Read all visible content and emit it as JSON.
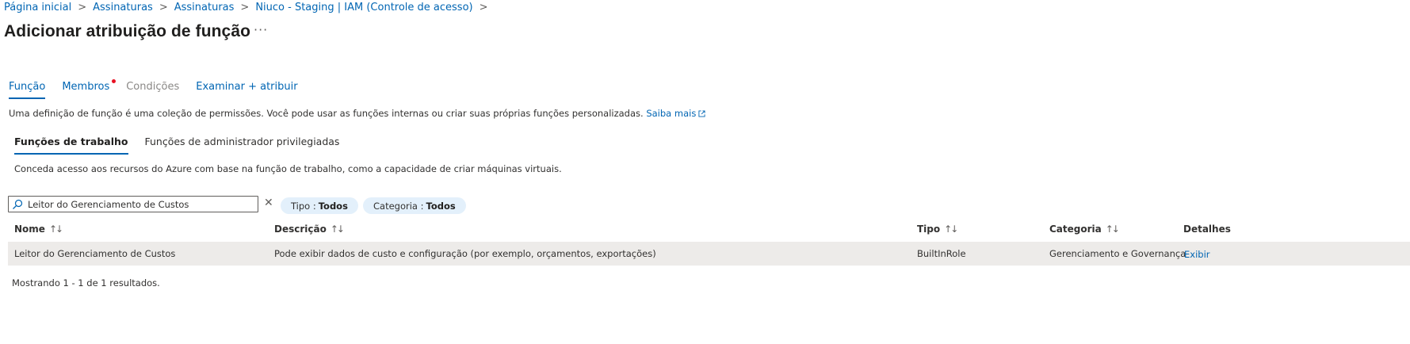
{
  "breadcrumb": {
    "items": [
      "Página inicial",
      "Assinaturas",
      "Assinaturas",
      "Niuco - Staging | IAM (Controle de acesso)"
    ],
    "separator": ">"
  },
  "page": {
    "title": "Adicionar atribuição de função",
    "more": "···"
  },
  "tabs": {
    "items": [
      "Função",
      "Membros",
      "Condições",
      "Examinar + atribuir"
    ]
  },
  "description": {
    "text": "Uma definição de função é uma coleção de permissões. Você pode usar as funções internas ou criar suas próprias funções personalizadas.",
    "link": "Saiba mais"
  },
  "subtabs": {
    "items": [
      "Funções de trabalho",
      "Funções de administrador privilegiadas"
    ]
  },
  "subdescription": "Conceda acesso aos recursos do Azure com base na função de trabalho, como a capacidade de criar máquinas virtuais.",
  "search": {
    "value": "Leitor do Gerenciamento de Custos",
    "clear": "✕"
  },
  "filters": {
    "tipo": {
      "label": "Tipo :",
      "value": "Todos"
    },
    "categoria": {
      "label": "Categoria :",
      "value": "Todos"
    }
  },
  "table": {
    "headers": [
      "Nome",
      "Descrição",
      "Tipo",
      "Categoria",
      "Detalhes"
    ],
    "sort_glyph": "↑↓",
    "rows": [
      {
        "nome": "Leitor do Gerenciamento de Custos",
        "descricao": "Pode exibir dados de custo e configuração (por exemplo, orçamentos, exportações)",
        "tipo": "BuiltInRole",
        "categoria": "Gerenciamento e Governança",
        "detalhes": "Exibir"
      }
    ]
  },
  "results": "Mostrando 1 - 1 de 1 resultados.",
  "colors": {
    "accent": "#0065b3",
    "pill_bg": "#e3f0fb",
    "row_selected": "#edebe9",
    "badge_dot": "#e81123"
  }
}
